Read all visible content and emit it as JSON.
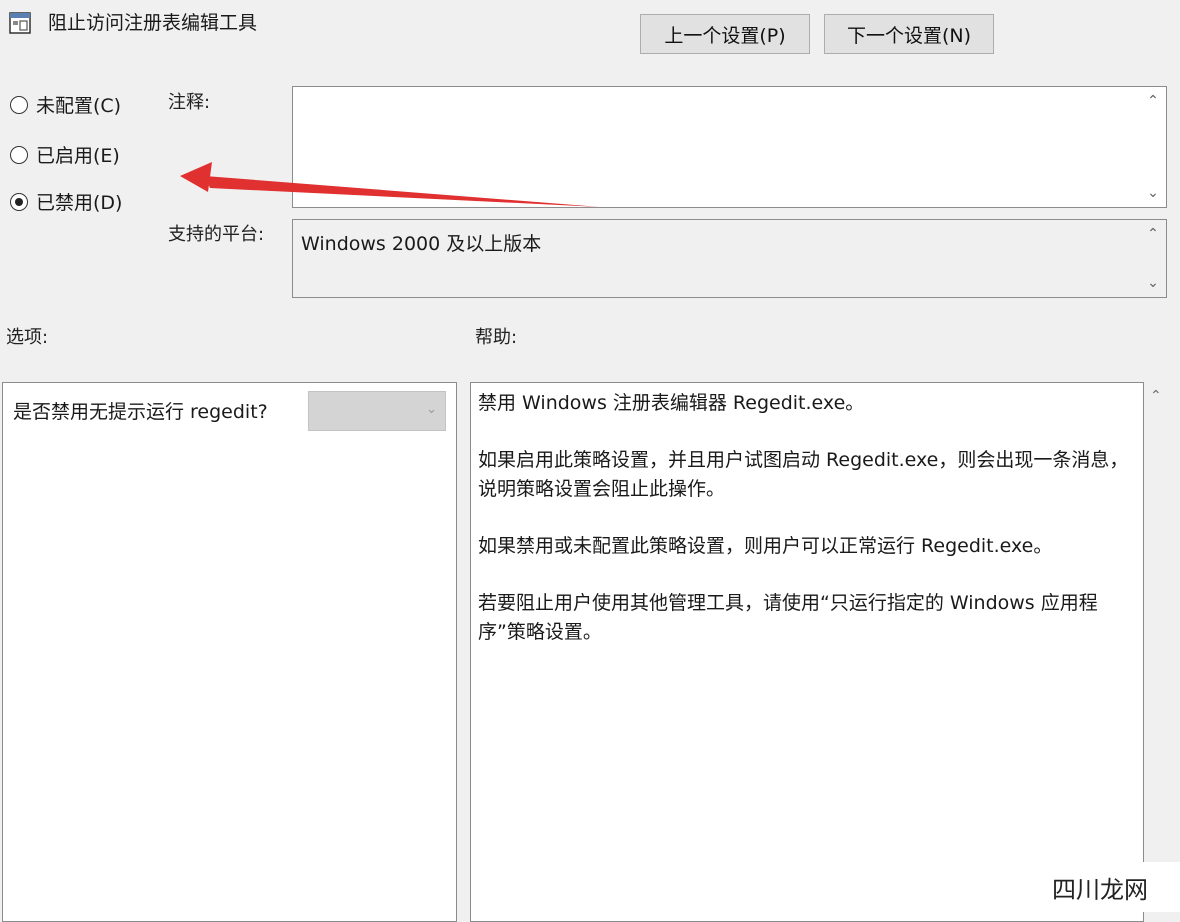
{
  "window": {
    "title": "阻止访问注册表编辑工具"
  },
  "nav": {
    "prev_label": "上一个设置(P)",
    "next_label": "下一个设置(N)"
  },
  "state": {
    "options": [
      {
        "label": "未配置(C)",
        "selected": false
      },
      {
        "label": "已启用(E)",
        "selected": false
      },
      {
        "label": "已禁用(D)",
        "selected": true
      }
    ]
  },
  "labels": {
    "comment": "注释:",
    "platform": "支持的平台:",
    "options": "选项:",
    "help": "帮助:"
  },
  "comment": {
    "value": ""
  },
  "platform": {
    "value": "Windows 2000 及以上版本"
  },
  "options_panel": {
    "question": "是否禁用无提示运行 regedit?",
    "select_value": ""
  },
  "help": {
    "paragraphs": [
      "禁用 Windows 注册表编辑器 Regedit.exe。",
      "如果启用此策略设置，并且用户试图启动 Regedit.exe，则会出现一条消息，说明策略设置会阻止此操作。",
      "如果禁用或未配置此策略设置，则用户可以正常运行 Regedit.exe。",
      "若要阻止用户使用其他管理工具，请使用“只运行指定的 Windows 应用程序”策略设置。"
    ]
  },
  "watermark": {
    "text": "四川龙网"
  },
  "colors": {
    "annotation_arrow": "#e03030"
  },
  "icons": [
    "policy-window-icon",
    "scroll-up-icon",
    "scroll-down-icon",
    "chevron-down-icon"
  ]
}
